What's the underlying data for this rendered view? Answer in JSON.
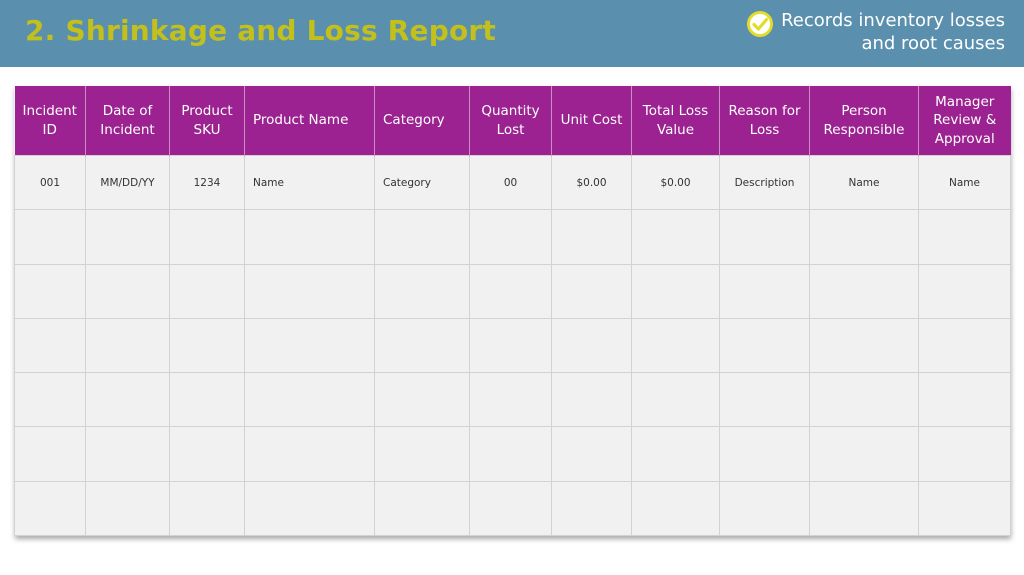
{
  "header": {
    "title": "2. Shrinkage and Loss Report",
    "subtitle_line1": "Records inventory losses",
    "subtitle_line2": "and root causes",
    "icon": "check-circle-icon",
    "colors": {
      "band": "#5a8fae",
      "title": "#c3c01c",
      "icon": "#e2dc2c"
    }
  },
  "table": {
    "header_color": "#9b2290",
    "columns": [
      "Incident ID",
      "Date of Incident",
      "Product SKU",
      "Product Name",
      "Category",
      "Quantity Lost",
      "Unit Cost",
      "Total Loss Value",
      "Reason for Loss",
      "Person Responsible",
      "Manager Review & Approval"
    ],
    "rows": [
      [
        "001",
        "MM/DD/YY",
        "1234",
        "Name",
        "Category",
        "00",
        "$0.00",
        "$0.00",
        "Description",
        "Name",
        "Name"
      ],
      [
        "",
        "",
        "",
        "",
        "",
        "",
        "",
        "",
        "",
        "",
        ""
      ],
      [
        "",
        "",
        "",
        "",
        "",
        "",
        "",
        "",
        "",
        "",
        ""
      ],
      [
        "",
        "",
        "",
        "",
        "",
        "",
        "",
        "",
        "",
        "",
        ""
      ],
      [
        "",
        "",
        "",
        "",
        "",
        "",
        "",
        "",
        "",
        "",
        ""
      ],
      [
        "",
        "",
        "",
        "",
        "",
        "",
        "",
        "",
        "",
        "",
        ""
      ],
      [
        "",
        "",
        "",
        "",
        "",
        "",
        "",
        "",
        "",
        "",
        ""
      ]
    ]
  }
}
